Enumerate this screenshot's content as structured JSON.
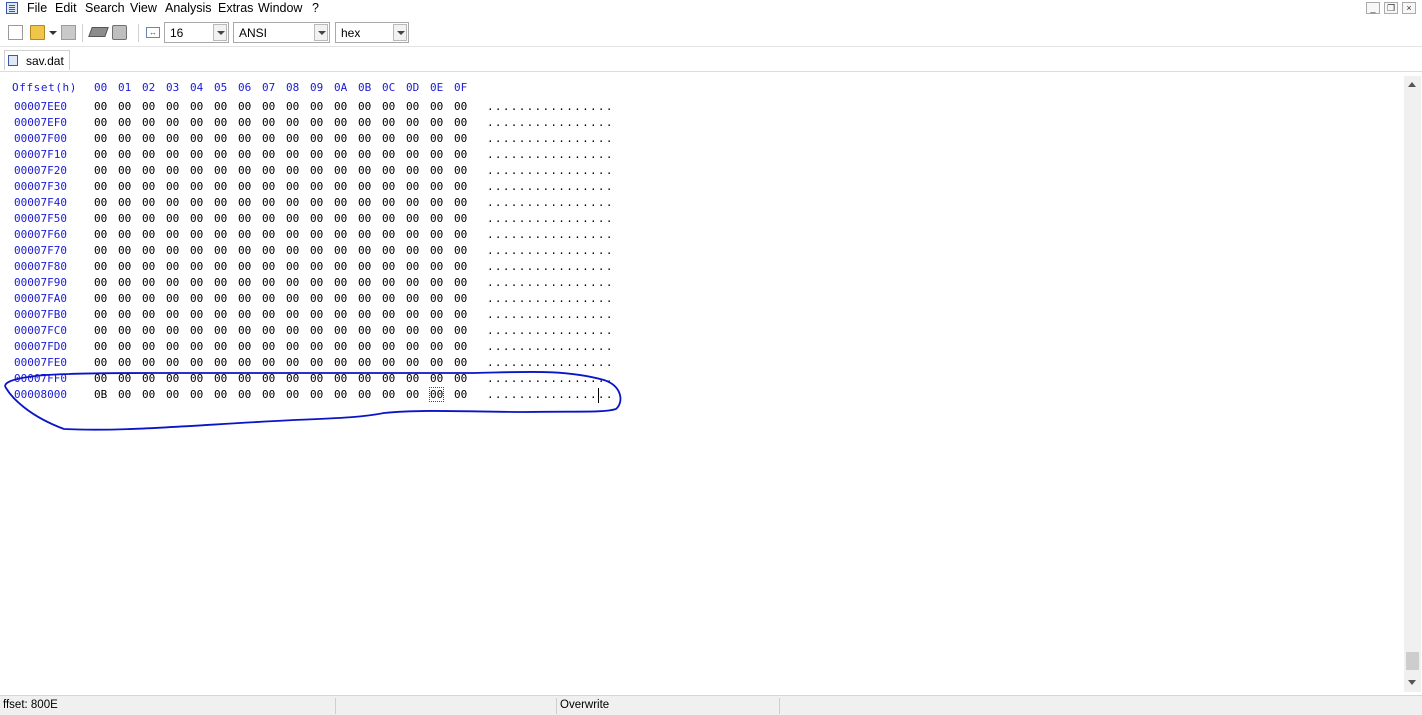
{
  "menu": [
    "File",
    "Edit",
    "Search",
    "View",
    "Analysis",
    "Extras",
    "Window",
    "?"
  ],
  "toolbar": {
    "bytes_per_row": "16",
    "charset": "ANSI",
    "offset_base": "hex"
  },
  "tab": {
    "label": "sav.dat"
  },
  "hex": {
    "offset_header": "Offset(h)",
    "columns": [
      "00",
      "01",
      "02",
      "03",
      "04",
      "05",
      "06",
      "07",
      "08",
      "09",
      "0A",
      "0B",
      "0C",
      "0D",
      "0E",
      "0F"
    ],
    "rows": [
      {
        "offset": "00007EE0",
        "bytes": [
          "00",
          "00",
          "00",
          "00",
          "00",
          "00",
          "00",
          "00",
          "00",
          "00",
          "00",
          "00",
          "00",
          "00",
          "00",
          "00"
        ],
        "ascii": "................"
      },
      {
        "offset": "00007EF0",
        "bytes": [
          "00",
          "00",
          "00",
          "00",
          "00",
          "00",
          "00",
          "00",
          "00",
          "00",
          "00",
          "00",
          "00",
          "00",
          "00",
          "00"
        ],
        "ascii": "................"
      },
      {
        "offset": "00007F00",
        "bytes": [
          "00",
          "00",
          "00",
          "00",
          "00",
          "00",
          "00",
          "00",
          "00",
          "00",
          "00",
          "00",
          "00",
          "00",
          "00",
          "00"
        ],
        "ascii": "................"
      },
      {
        "offset": "00007F10",
        "bytes": [
          "00",
          "00",
          "00",
          "00",
          "00",
          "00",
          "00",
          "00",
          "00",
          "00",
          "00",
          "00",
          "00",
          "00",
          "00",
          "00"
        ],
        "ascii": "................"
      },
      {
        "offset": "00007F20",
        "bytes": [
          "00",
          "00",
          "00",
          "00",
          "00",
          "00",
          "00",
          "00",
          "00",
          "00",
          "00",
          "00",
          "00",
          "00",
          "00",
          "00"
        ],
        "ascii": "................"
      },
      {
        "offset": "00007F30",
        "bytes": [
          "00",
          "00",
          "00",
          "00",
          "00",
          "00",
          "00",
          "00",
          "00",
          "00",
          "00",
          "00",
          "00",
          "00",
          "00",
          "00"
        ],
        "ascii": "................"
      },
      {
        "offset": "00007F40",
        "bytes": [
          "00",
          "00",
          "00",
          "00",
          "00",
          "00",
          "00",
          "00",
          "00",
          "00",
          "00",
          "00",
          "00",
          "00",
          "00",
          "00"
        ],
        "ascii": "................"
      },
      {
        "offset": "00007F50",
        "bytes": [
          "00",
          "00",
          "00",
          "00",
          "00",
          "00",
          "00",
          "00",
          "00",
          "00",
          "00",
          "00",
          "00",
          "00",
          "00",
          "00"
        ],
        "ascii": "................"
      },
      {
        "offset": "00007F60",
        "bytes": [
          "00",
          "00",
          "00",
          "00",
          "00",
          "00",
          "00",
          "00",
          "00",
          "00",
          "00",
          "00",
          "00",
          "00",
          "00",
          "00"
        ],
        "ascii": "................"
      },
      {
        "offset": "00007F70",
        "bytes": [
          "00",
          "00",
          "00",
          "00",
          "00",
          "00",
          "00",
          "00",
          "00",
          "00",
          "00",
          "00",
          "00",
          "00",
          "00",
          "00"
        ],
        "ascii": "................"
      },
      {
        "offset": "00007F80",
        "bytes": [
          "00",
          "00",
          "00",
          "00",
          "00",
          "00",
          "00",
          "00",
          "00",
          "00",
          "00",
          "00",
          "00",
          "00",
          "00",
          "00"
        ],
        "ascii": "................"
      },
      {
        "offset": "00007F90",
        "bytes": [
          "00",
          "00",
          "00",
          "00",
          "00",
          "00",
          "00",
          "00",
          "00",
          "00",
          "00",
          "00",
          "00",
          "00",
          "00",
          "00"
        ],
        "ascii": "................"
      },
      {
        "offset": "00007FA0",
        "bytes": [
          "00",
          "00",
          "00",
          "00",
          "00",
          "00",
          "00",
          "00",
          "00",
          "00",
          "00",
          "00",
          "00",
          "00",
          "00",
          "00"
        ],
        "ascii": "................"
      },
      {
        "offset": "00007FB0",
        "bytes": [
          "00",
          "00",
          "00",
          "00",
          "00",
          "00",
          "00",
          "00",
          "00",
          "00",
          "00",
          "00",
          "00",
          "00",
          "00",
          "00"
        ],
        "ascii": "................"
      },
      {
        "offset": "00007FC0",
        "bytes": [
          "00",
          "00",
          "00",
          "00",
          "00",
          "00",
          "00",
          "00",
          "00",
          "00",
          "00",
          "00",
          "00",
          "00",
          "00",
          "00"
        ],
        "ascii": "................"
      },
      {
        "offset": "00007FD0",
        "bytes": [
          "00",
          "00",
          "00",
          "00",
          "00",
          "00",
          "00",
          "00",
          "00",
          "00",
          "00",
          "00",
          "00",
          "00",
          "00",
          "00"
        ],
        "ascii": "................"
      },
      {
        "offset": "00007FE0",
        "bytes": [
          "00",
          "00",
          "00",
          "00",
          "00",
          "00",
          "00",
          "00",
          "00",
          "00",
          "00",
          "00",
          "00",
          "00",
          "00",
          "00"
        ],
        "ascii": "................"
      },
      {
        "offset": "00007FF0",
        "bytes": [
          "00",
          "00",
          "00",
          "00",
          "00",
          "00",
          "00",
          "00",
          "00",
          "00",
          "00",
          "00",
          "00",
          "00",
          "00",
          "00"
        ],
        "ascii": "................"
      },
      {
        "offset": "00008000",
        "bytes": [
          "0B",
          "00",
          "00",
          "00",
          "00",
          "00",
          "00",
          "00",
          "00",
          "00",
          "00",
          "00",
          "00",
          "00",
          "00",
          "00"
        ],
        "ascii": "................"
      }
    ]
  },
  "status": {
    "offset": "ffset: 800E",
    "mode": "Overwrite"
  },
  "colors": {
    "offset_blue": "#1a1ad8",
    "annotation_blue": "#0a14c8"
  }
}
